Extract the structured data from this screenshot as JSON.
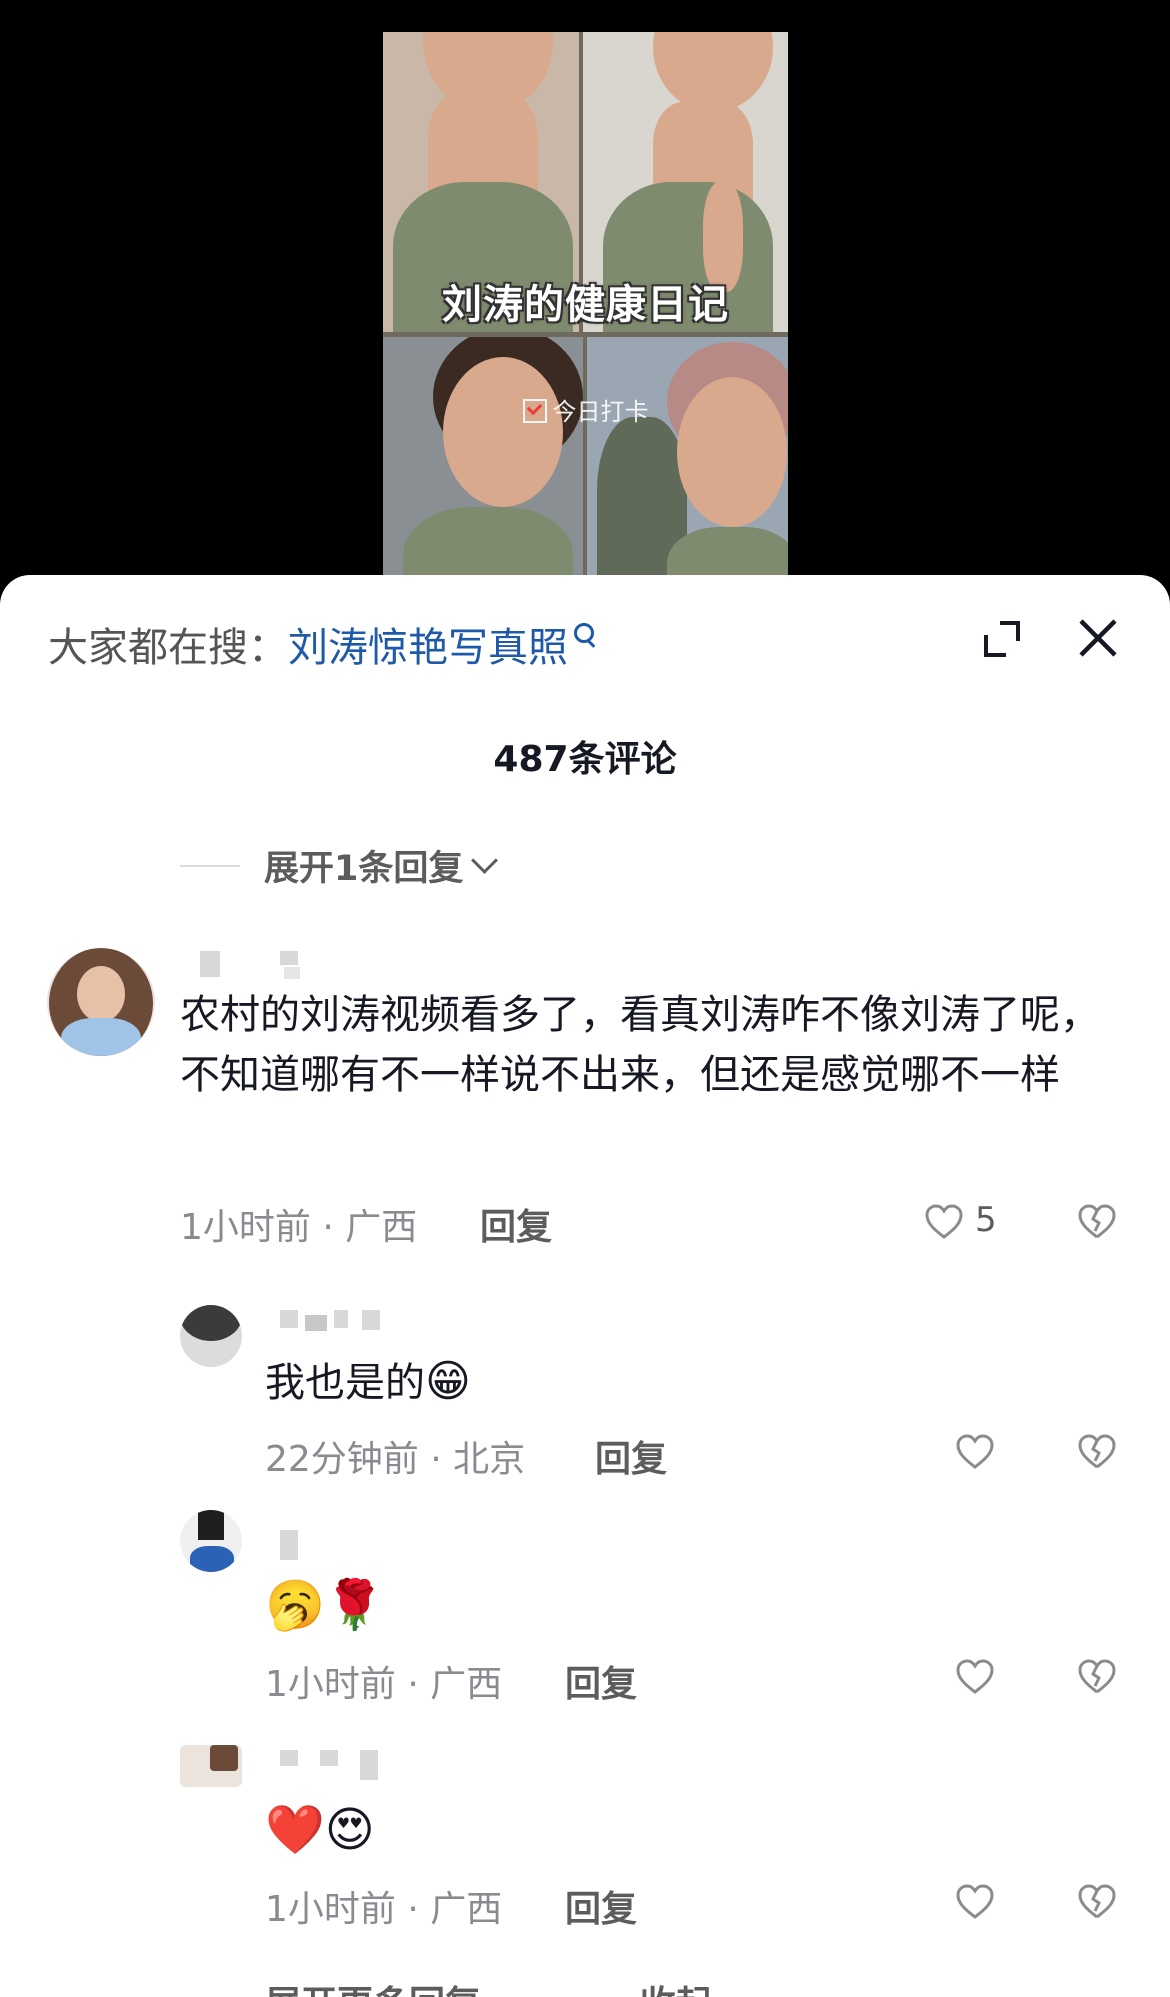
{
  "video": {
    "title_overlay": "刘涛的健康日记",
    "subtitle_overlay": "今日打卡"
  },
  "search": {
    "prefix": "大家都在搜：",
    "term": "刘涛惊艳写真照"
  },
  "comments_count": "487条评论",
  "expand_replies": "展开1条回复",
  "comments": [
    {
      "text": "农村的刘涛视频看多了，看真刘涛咋不像刘涛了呢，不知道哪有不一样说不出来，但还是感觉哪不一样",
      "time_location": "1小时前 · 广西",
      "reply_label": "回复",
      "likes": "5"
    }
  ],
  "replies": [
    {
      "text": "我也是的",
      "emoji": "😁",
      "time_location": "22分钟前 · 北京",
      "reply_label": "回复"
    },
    {
      "text": "",
      "emoji": "🥱🌹",
      "time_location": "1小时前 · 广西",
      "reply_label": "回复"
    },
    {
      "text": "",
      "emoji": "❤️😍",
      "time_location": "1小时前 · 广西",
      "reply_label": "回复"
    }
  ],
  "footer": {
    "more_replies": "展开更多回复",
    "collapse": "收起"
  },
  "icons": {
    "expand": "expand-icon",
    "close": "close-icon",
    "like": "heart-outline-icon",
    "dislike": "broken-heart-icon",
    "search": "search-icon"
  },
  "colors": {
    "search_term": "#1f5aa8",
    "meta_text": "#8a8b91"
  }
}
